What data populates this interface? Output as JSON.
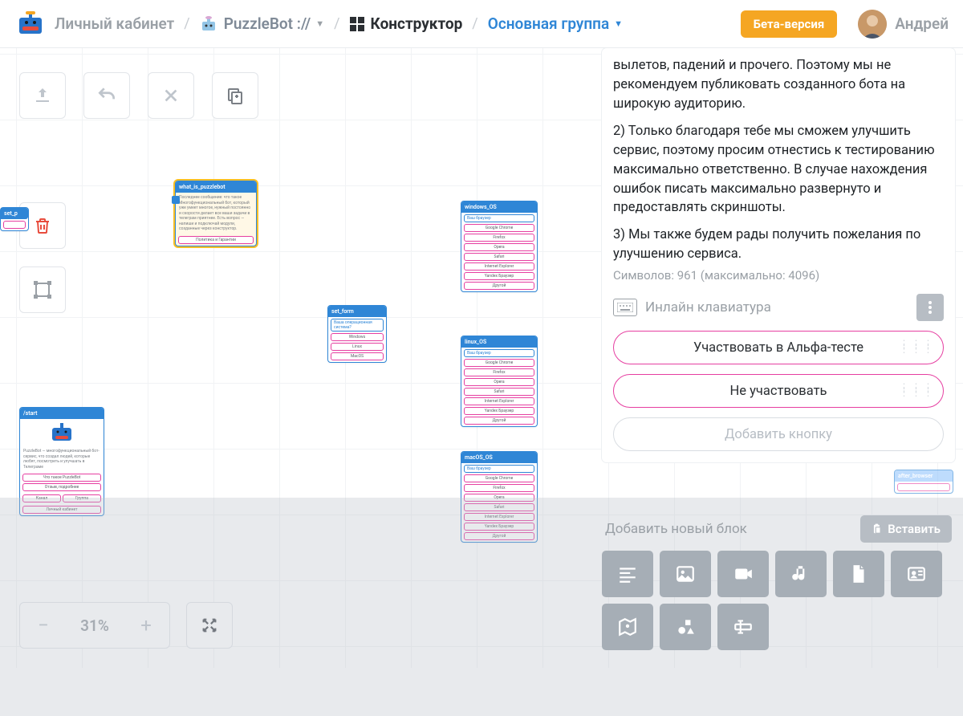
{
  "header": {
    "personal_cabinet": "Личный кабинет",
    "bot_name": "PuzzleBot ://",
    "constructor": "Конструктор",
    "main_group": "Основная группа",
    "beta_label": "Бета-версия",
    "username": "Андрей"
  },
  "zoom": {
    "value": "31%"
  },
  "nodes": {
    "flagcut": {
      "title": "set_p"
    },
    "puzzle": {
      "title": "what_is_puzzlebot",
      "body": "Последнее сообщение: что такое\nМногофункциональный бот, который уже умеет\nмногое, нужный постоянно и скорости делает все\nваши задачи в телеграм приятнее. Есть вопрос —\nнапиши и подключай модули, созданные через конструктор.",
      "rows": [
        "Политика и Гарантии"
      ]
    },
    "start": {
      "title": "/start",
      "body": "PuzzleBot — многофункциональный бот-сервис, что создал людей, которые любят, посмотреть и улучшать в Телеграме",
      "rows": [
        "Что такое PuzzleBot",
        "Отзыв, подробнее",
        "Канал",
        "Группа",
        "Личный кабинет"
      ]
    },
    "setform": {
      "title": "set_form",
      "rows_blue": [
        "Ваша операционная система?"
      ],
      "rows": [
        "Windows",
        "Linux",
        "MacOS"
      ]
    },
    "win": {
      "title": "windows_OS",
      "rows_blue": [
        "Ваш браузер"
      ],
      "rows": [
        "Google Chrome",
        "Firefox",
        "Opera",
        "Safari",
        "Internet Explorer",
        "Yandex Браузер",
        "Другой"
      ]
    },
    "linux": {
      "title": "linux_OS",
      "rows_blue": [
        "Ваш браузер"
      ],
      "rows": [
        "Google Chrome",
        "Firefox",
        "Opera",
        "Safari",
        "Internet Explorer",
        "Yandex Браузер",
        "Другой"
      ]
    },
    "mac": {
      "title": "macOS_OS",
      "rows_blue": [
        "Ваш браузер"
      ],
      "rows": [
        "Google Chrome",
        "Firefox",
        "Opera",
        "Safari",
        "Internet Explorer",
        "Yandex Браузер",
        "Другой"
      ]
    },
    "ghost": {
      "title": "after_browser"
    }
  },
  "panel": {
    "msg_p1": "вылетов, падений и прочего. Поэтому мы не рекомендуем публиковать созданного бота на широкую аудиторию.",
    "msg_p2": "2) Только благодаря тебе мы сможем улучшить сервис, поэтому просим отнестись к тестированию максимально ответственно. В случае нахождения ошибок писать максимально развернуто и предоставлять скриншоты.",
    "msg_p3": "3) Мы также будем рады получить пожелания по улучшению сервиса.",
    "char_count": "Символов: 961 (максимально: 4096)",
    "kbd_label": "Инлайн клавиатура",
    "pill1": "Участвовать в Альфа-тесте",
    "pill2": "Не участвовать",
    "pill_add": "Добавить кнопку"
  },
  "addblock": {
    "title": "Добавить новый блок",
    "paste": "Вставить"
  }
}
